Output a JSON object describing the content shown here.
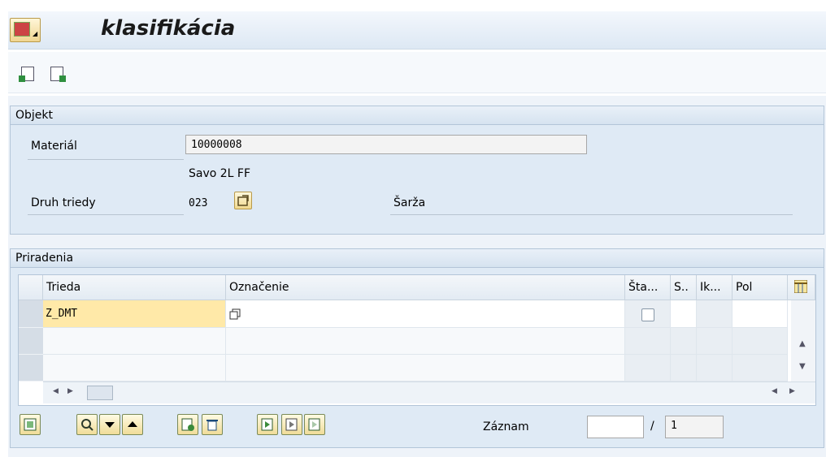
{
  "window": {
    "title": "klasifikácia"
  },
  "objekt": {
    "group_title": "Objekt",
    "material_label": "Materiál",
    "material_value": "10000008",
    "material_desc": "Savo 2L FF",
    "druh_label": "Druh triedy",
    "druh_value": "023",
    "druh_desc": "Šarža"
  },
  "priradenia": {
    "group_title": "Priradenia",
    "columns": [
      "Trieda",
      "Označenie",
      "Šta...",
      "S..",
      "Ik...",
      "Pol"
    ],
    "rows": [
      {
        "trieda": "Z_DMT",
        "oznacenie": "",
        "status_checked": false
      }
    ]
  },
  "footer": {
    "zaznam_label": "Záznam",
    "zaznam_value": "",
    "separator": "/",
    "total": "1"
  },
  "icons": {
    "menu": "sap-menu-icon",
    "prev": "previous-document-icon",
    "next": "next-document-icon",
    "choose": "choose-values-icon",
    "config": "table-settings-icon"
  },
  "colors": {
    "title_bar": "#dde8f4",
    "group_bg": "#dfeaf5",
    "selected_cell": "#ffe9a8",
    "button_gold": "#f0d590"
  }
}
